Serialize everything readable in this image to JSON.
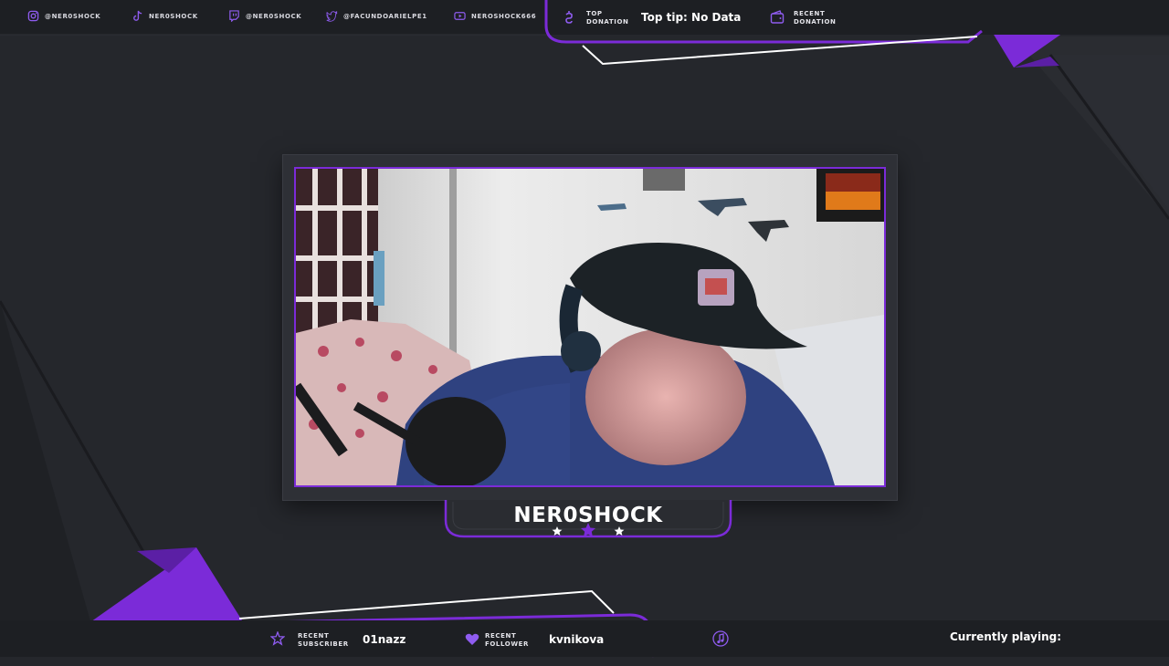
{
  "colors": {
    "accent": "#7b2bd8",
    "background": "#25272c",
    "bar": "#1d1f23"
  },
  "top_bar": {
    "socials": [
      {
        "icon": "instagram-icon",
        "handle": "@NER0SHOCK"
      },
      {
        "icon": "tiktok-icon",
        "handle": "NER0SHOCK"
      },
      {
        "icon": "twitch-icon",
        "handle": "@NER0SHOCK"
      },
      {
        "icon": "twitter-icon",
        "handle": "@FACUNDOARIELPE1"
      },
      {
        "icon": "youtube-icon",
        "handle": "NEROSHOCK666"
      }
    ],
    "top_donation_label": "TOP\nDONATION",
    "top_donation_value": "Top tip: No Data",
    "recent_donation_label": "RECENT\nDONATION"
  },
  "streamer": {
    "name": "NER0SHOCK"
  },
  "bottom_bar": {
    "recent_subscriber_label": "RECENT\nSUBSCRIBER",
    "recent_subscriber_value": "01nazz",
    "recent_follower_label": "RECENT\nFOLLOWER",
    "recent_follower_value": "kvnikova",
    "music_icon": "music-note-icon",
    "currently_playing_label": "Currently playing:"
  }
}
